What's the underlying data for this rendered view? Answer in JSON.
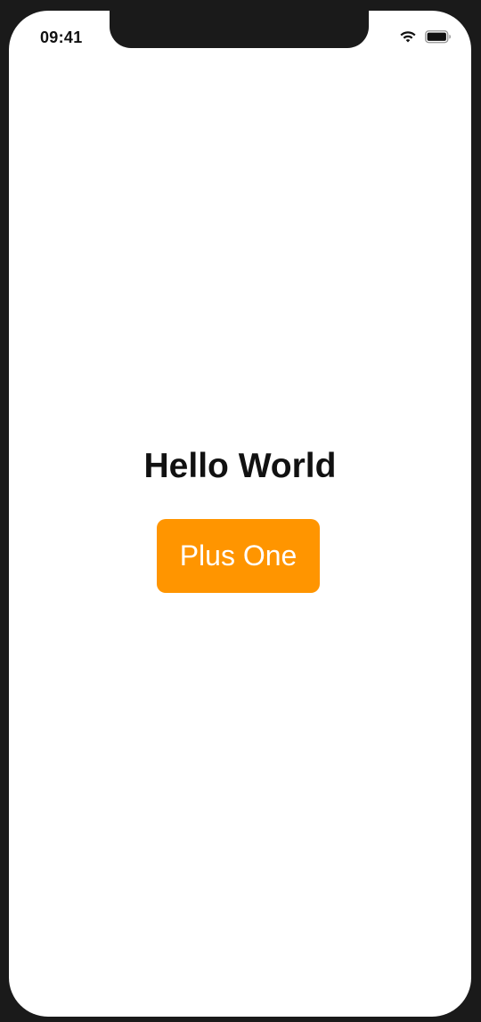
{
  "status_bar": {
    "time": "09:41",
    "wifi_icon": "wifi-icon",
    "battery_icon": "battery-icon"
  },
  "main": {
    "title": "Hello World",
    "button_label": "Plus One"
  },
  "colors": {
    "accent": "#ff9500",
    "background": "#ffffff",
    "text": "#111111",
    "device_frame": "#1a1a1a"
  }
}
